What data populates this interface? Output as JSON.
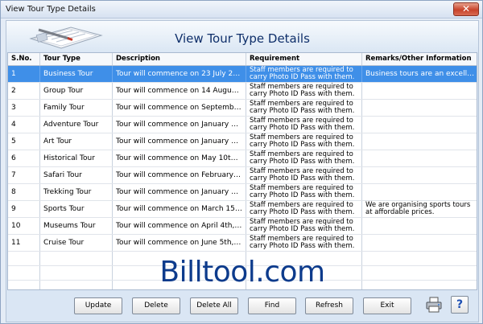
{
  "window": {
    "title": "View Tour Type Details",
    "close_label": "✕"
  },
  "page_title": "View Tour Type Details",
  "columns": [
    "S.No.",
    "Tour Type",
    "Description",
    "Requirement",
    "Remarks/Other Information"
  ],
  "rows": [
    {
      "sno": "1",
      "type": "Business Tour",
      "desc": "Tour will commence on 23 July 27,...",
      "req": "Staff members are required to carry Photo ID Pass with them.",
      "remarks": "Business tours are an excellen...",
      "selected": true
    },
    {
      "sno": "2",
      "type": "Group Tour",
      "desc": "Tour will commence on 14 August,...",
      "req": "Staff members are required to carry Photo ID Pass with them.",
      "remarks": ""
    },
    {
      "sno": "3",
      "type": "Family Tour",
      "desc": "Tour will commence on September...",
      "req": "Staff members are required to carry Photo ID Pass with them.",
      "remarks": ""
    },
    {
      "sno": "4",
      "type": "Adventure Tour",
      "desc": "Tour will commence on January 3r...",
      "req": "Staff members are required to carry Photo ID Pass with them.",
      "remarks": ""
    },
    {
      "sno": "5",
      "type": "Art Tour",
      "desc": "Tour will commence on January 2n...",
      "req": "Staff members are required to carry Photo ID Pass with them.",
      "remarks": ""
    },
    {
      "sno": "6",
      "type": "Historical Tour",
      "desc": "Tour will commence on May 10th, ...",
      "req": "Staff members are required to carry Photo ID Pass with them.",
      "remarks": ""
    },
    {
      "sno": "7",
      "type": "Safari Tour",
      "desc": "Tour will commence on February 1...",
      "req": "Staff members are required to carry Photo ID Pass with them.",
      "remarks": ""
    },
    {
      "sno": "8",
      "type": "Trekking Tour",
      "desc": "Tour will commence on January 26...",
      "req": "Staff members are required to carry Photo ID Pass with them.",
      "remarks": ""
    },
    {
      "sno": "9",
      "type": "Sports Tour",
      "desc": "Tour will commence on March 15th...",
      "req": "Staff members are required to carry Photo ID Pass with them.",
      "remarks": "We are organising sports tours at affordable prices."
    },
    {
      "sno": "10",
      "type": "Museums Tour",
      "desc": "Tour will commence on April 4th, 2...",
      "req": "Staff members are required to carry Photo ID Pass with them.",
      "remarks": ""
    },
    {
      "sno": "11",
      "type": "Cruise Tour",
      "desc": "Tour will commence on June 5th, 2...",
      "req": "Staff members are required to carry Photo ID Pass with them.",
      "remarks": ""
    }
  ],
  "watermark": "Billtool.com",
  "buttons": {
    "update": "Update",
    "delete": "Delete",
    "delete_all": "Delete All",
    "find": "Find",
    "refresh": "Refresh",
    "exit": "Exit",
    "help": "?"
  },
  "colors": {
    "selected_row": "#3f8fe8",
    "title_text": "#0f2f6a",
    "watermark": "#0d3b8c"
  }
}
